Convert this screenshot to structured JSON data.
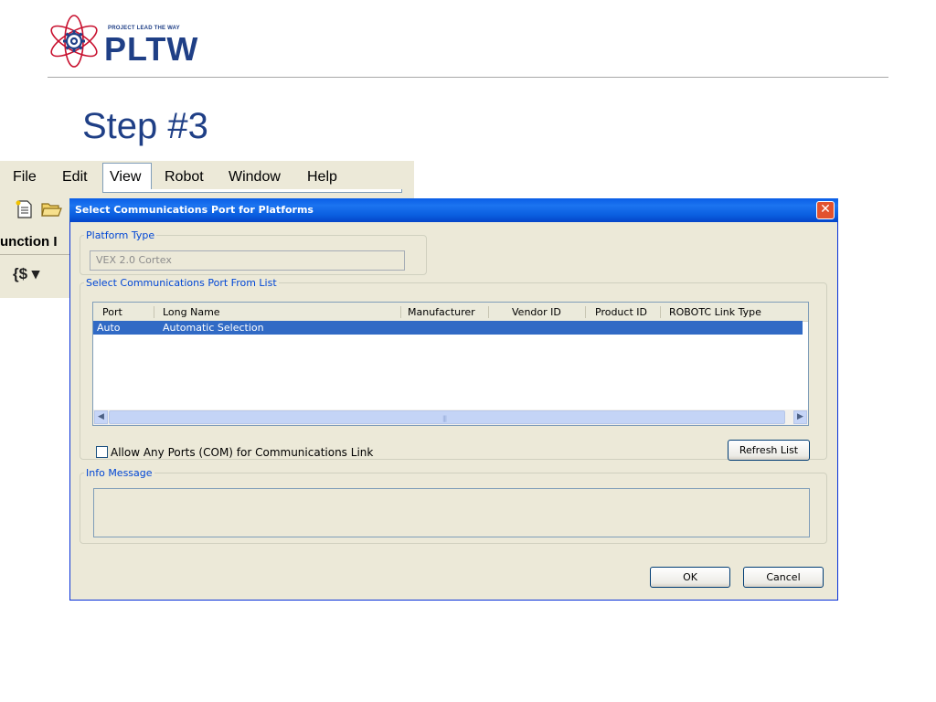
{
  "logo": {
    "small_text": "PROJECT LEAD THE WAY",
    "big_text": "PLTW",
    "icon": "atom-gear-icon"
  },
  "slide": {
    "title": "Step #3"
  },
  "app": {
    "menu": [
      "File",
      "Edit",
      "View",
      "Robot",
      "Window",
      "Help"
    ],
    "toolbar_icons": [
      "new-file-icon",
      "open-folder-icon"
    ],
    "function_label": "unction I",
    "brace_button": "{$ ▾"
  },
  "dialog": {
    "title": "Select Communications Port for Platforms",
    "platform_group": {
      "legend": "Platform Type",
      "value": "VEX 2.0 Cortex"
    },
    "ports_group": {
      "legend": "Select Communications Port From List",
      "columns": [
        "Port",
        "Long Name",
        "Manufacturer",
        "Vendor ID",
        "Product ID",
        "ROBOTC Link Type"
      ],
      "rows": [
        {
          "port": "Auto",
          "long_name": "Automatic Selection",
          "manufacturer": "",
          "vendor_id": "",
          "product_id": "",
          "link_type": "",
          "selected": true
        }
      ],
      "checkbox_label": "Allow Any Ports (COM) for Communications Link",
      "checkbox_checked": false,
      "refresh_label": "Refresh List"
    },
    "info_group": {
      "legend": "Info Message",
      "message": ""
    },
    "ok_label": "OK",
    "cancel_label": "Cancel"
  },
  "colors": {
    "brand_blue": "#1f3f86",
    "titlebar_blue": "#0a5ee6",
    "selection_blue": "#316ac5",
    "dialog_bg": "#ece9d8",
    "legend_blue": "#0046d5"
  }
}
